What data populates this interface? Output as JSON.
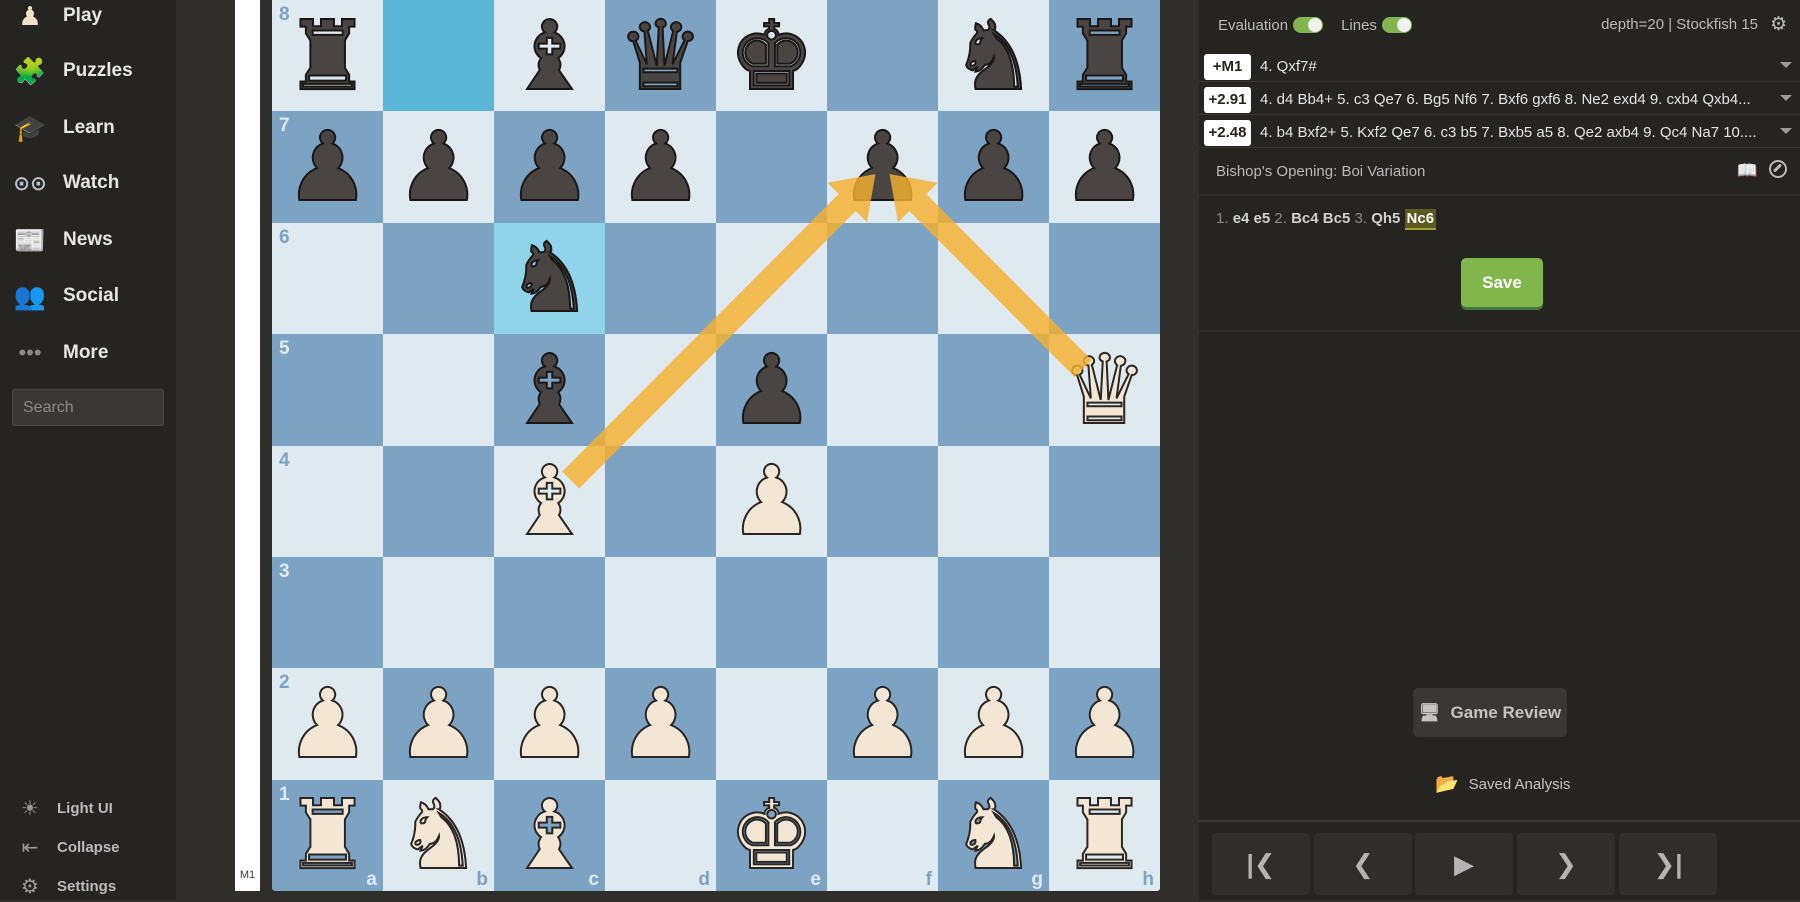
{
  "sidebar": {
    "items": [
      {
        "label": "Play",
        "icon": "play-pawn-hand-icon",
        "glyph": "♟"
      },
      {
        "label": "Puzzles",
        "icon": "puzzle-icon",
        "glyph": "🧩"
      },
      {
        "label": "Learn",
        "icon": "graduation-cap-icon",
        "glyph": "🎓"
      },
      {
        "label": "Watch",
        "icon": "binoculars-icon",
        "glyph": "⊙⊙"
      },
      {
        "label": "News",
        "icon": "newspaper-icon",
        "glyph": "📰"
      },
      {
        "label": "Social",
        "icon": "people-icon",
        "glyph": "👥"
      },
      {
        "label": "More",
        "icon": "more-dots-icon",
        "glyph": "•••"
      }
    ],
    "search_placeholder": "Search",
    "footer": [
      {
        "label": "Light UI",
        "icon": "sun-icon",
        "glyph": "☀"
      },
      {
        "label": "Collapse",
        "icon": "collapse-icon",
        "glyph": "⇤"
      },
      {
        "label": "Settings",
        "icon": "gear-icon",
        "glyph": "⚙"
      }
    ]
  },
  "eval_bar": {
    "label": "M1",
    "white_fraction": 1.0
  },
  "board": {
    "orientation": "white",
    "files": [
      "a",
      "b",
      "c",
      "d",
      "e",
      "f",
      "g",
      "h"
    ],
    "ranks": [
      "8",
      "7",
      "6",
      "5",
      "4",
      "3",
      "2",
      "1"
    ],
    "position": [
      [
        "r",
        "",
        "b",
        "q",
        "k",
        "",
        "n",
        "r"
      ],
      [
        "p",
        "p",
        "p",
        "p",
        "",
        "p",
        "p",
        "p"
      ],
      [
        "",
        "",
        "n",
        "",
        "",
        "",
        "",
        ""
      ],
      [
        "",
        "",
        "b",
        "",
        "p",
        "",
        "",
        "Q"
      ],
      [
        "",
        "",
        "B",
        "",
        "P",
        "",
        "",
        ""
      ],
      [
        "",
        "",
        "",
        "",
        "",
        "",
        "",
        ""
      ],
      [
        "P",
        "P",
        "P",
        "P",
        "",
        "P",
        "P",
        "P"
      ],
      [
        "R",
        "N",
        "B",
        "",
        "K",
        "",
        "N",
        "R"
      ]
    ],
    "last_move": {
      "from": "b8",
      "to": "c6"
    },
    "arrows": [
      {
        "from": "c4",
        "to": "f7",
        "color": "#f5b12e"
      },
      {
        "from": "h5",
        "to": "f7",
        "color": "#f5b12e"
      }
    ],
    "colors": {
      "light": "#dfe9f0",
      "dark": "#7ca3c3",
      "highlight_from": "#5bb6d6",
      "highlight_to": "#8fd4ea"
    }
  },
  "analysis": {
    "evaluation_label": "Evaluation",
    "evaluation_on": true,
    "lines_label": "Lines",
    "lines_on": true,
    "engine_info": "depth=20 | Stockfish 15",
    "lines": [
      {
        "eval": "+M1",
        "moves": "4. Qxf7#"
      },
      {
        "eval": "+2.91",
        "moves": "4. d4 Bb4+ 5. c3 Qe7 6. Bg5 Nf6 7. Bxf6 gxf6 8. Ne2 exd4 9. cxb4 Qxb4..."
      },
      {
        "eval": "+2.48",
        "moves": "4. b4 Bxf2+ 5. Kxf2 Qe7 6. c3 b5 7. Bxb5 a5 8. Qe2 axb4 9. Qc4 Na7 10...."
      }
    ],
    "opening_name": "Bishop's Opening: Boi Variation",
    "moves": [
      {
        "num": "1.",
        "white": "e4",
        "black": "e5"
      },
      {
        "num": "2.",
        "white": "Bc4",
        "black": "Bc5"
      },
      {
        "num": "3.",
        "white": "Qh5",
        "black": "Nc6"
      }
    ],
    "current_move": "Nc6",
    "save_label": "Save",
    "game_review_label": "Game Review",
    "saved_analysis_label": "Saved Analysis",
    "nav_buttons": [
      {
        "name": "first-move-button",
        "glyph": "|❮"
      },
      {
        "name": "previous-move-button",
        "glyph": "❮"
      },
      {
        "name": "play-button",
        "glyph": "▶"
      },
      {
        "name": "next-move-button",
        "glyph": "❯"
      },
      {
        "name": "last-move-button",
        "glyph": "❯|"
      }
    ]
  }
}
